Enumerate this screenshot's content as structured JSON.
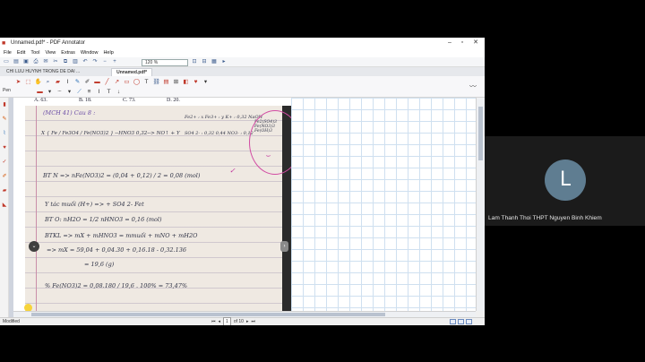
{
  "window": {
    "title": "Unnamed.pdf* - PDF Annotator",
    "menu": [
      "File",
      "Edit",
      "Tool",
      "View",
      "Extras",
      "Window",
      "Help"
    ],
    "zoom": "120 %",
    "tabs": [
      "CHI LUU HUYNH TRONG DE DAI ...",
      "Unnamed.pdf*"
    ],
    "pen_label": "Pen",
    "status": "Modified",
    "page_nav": {
      "current": "1",
      "of_label": "of 10"
    }
  },
  "document": {
    "top_options": [
      "A. 63.",
      "B. 18.",
      "C. 73.",
      "D. 20."
    ],
    "handwriting": [
      "(MCH 41)  Cau 8 :",
      "X { Fe / Fe3O4 / Fe(NO3)2 }  --HNO3 0,32-->  NO↑ + Y",
      "Fe2+ : x   Fe3+ : y   K+ : 0,32 NaOH",
      "SO4 2- : 0,32   0,44   NO3- : 0,12",
      "Fe2(SO4)3   Fe(NO3)3   Fe(OH)3",
      "BT N => nFe(NO3)2 = (0,04 + 0,12) / 2 = 0,08 (mol)",
      "Y tác muối  (H+) => + SO4 2- Fet",
      "BT O: nH2O = 1/2 nHNO3 = 0,16 (mol)",
      "BTKL => mX + mHNO3 = mmuối + mNO + mH2O",
      "=> mX = 59,04 + 0,04.30 + 0,16.18 - 0,32.136",
      "= 19,6 (g)",
      "% Fe(NO3)2 = 0,08.180 / 19,6 . 100% = 73,47%"
    ]
  },
  "participant": {
    "initial": "L",
    "name": "Lam Thanh Thoi THPT Nguyen Binh Khiem"
  },
  "colors": {
    "pink_annotation": "#d24ca3",
    "avatar_bg": "#5f7d91",
    "grid_line": "#cfe0f0"
  }
}
